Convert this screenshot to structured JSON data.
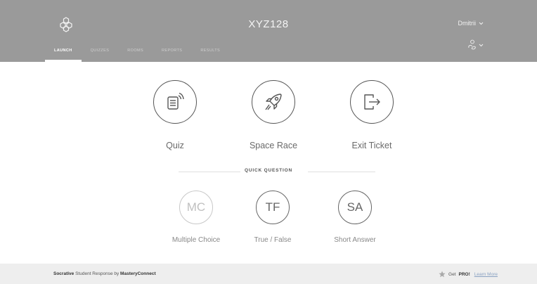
{
  "header": {
    "room_name": "XYZ128",
    "user_name": "Dmitrii",
    "nav": [
      {
        "label": "LAUNCH",
        "active": true
      },
      {
        "label": "QUIZZES",
        "active": false
      },
      {
        "label": "ROOMS",
        "active": false
      },
      {
        "label": "REPORTS",
        "active": false
      },
      {
        "label": "RESULTS",
        "active": false
      }
    ]
  },
  "activities": [
    {
      "label": "Quiz",
      "icon": "quiz-document-icon"
    },
    {
      "label": "Space Race",
      "icon": "rocket-icon"
    },
    {
      "label": "Exit Ticket",
      "icon": "exit-door-icon"
    }
  ],
  "quick_question": {
    "title": "QUICK QUESTION",
    "options": [
      {
        "abbr": "MC",
        "label": "Multiple Choice"
      },
      {
        "abbr": "TF",
        "label": "True / False"
      },
      {
        "abbr": "SA",
        "label": "Short Answer"
      }
    ]
  },
  "footer": {
    "brand": "Socrative",
    "middle": " Student Response by ",
    "company": "MasteryConnect",
    "pro_prefix": "Get ",
    "pro_label": "PRO!",
    "learn_more": "Learn More"
  },
  "colors": {
    "header_bg": "#9a9a9a",
    "footer_bg": "#eeeeee",
    "link": "#8aa2c2"
  }
}
